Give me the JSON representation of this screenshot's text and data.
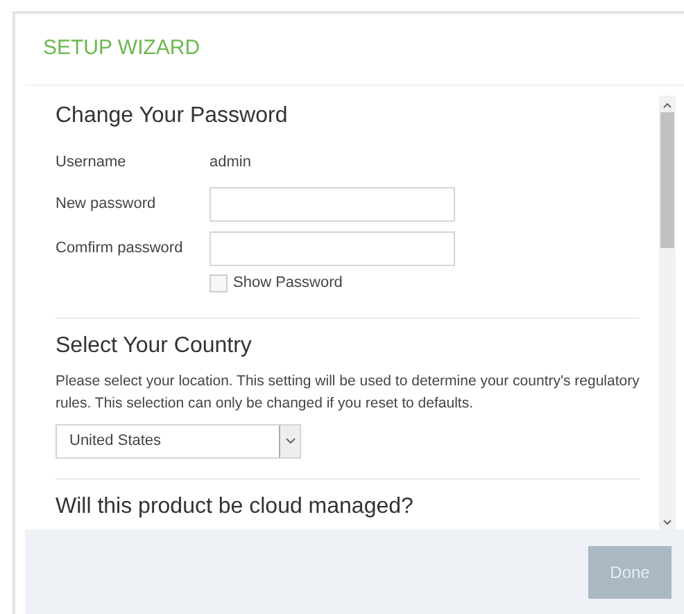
{
  "title": "SETUP WIZARD",
  "password_section": {
    "heading": "Change Your Password",
    "username_label": "Username",
    "username": "admin",
    "fields": [
      {
        "label": "New password"
      },
      {
        "label": "Comfirm password"
      }
    ],
    "show_password": {
      "label": "Show Password",
      "checked": false
    }
  },
  "country_section": {
    "heading": "Select Your Country",
    "description": "Please select your location. This setting will be used to determine your country's regulatory rules. This selection can only be changed if you reset to defaults.",
    "selected_country": "United States"
  },
  "cloud_section": {
    "heading": "Will this product be cloud managed?"
  },
  "done_button": {
    "label": "Done",
    "disabled": true
  }
}
